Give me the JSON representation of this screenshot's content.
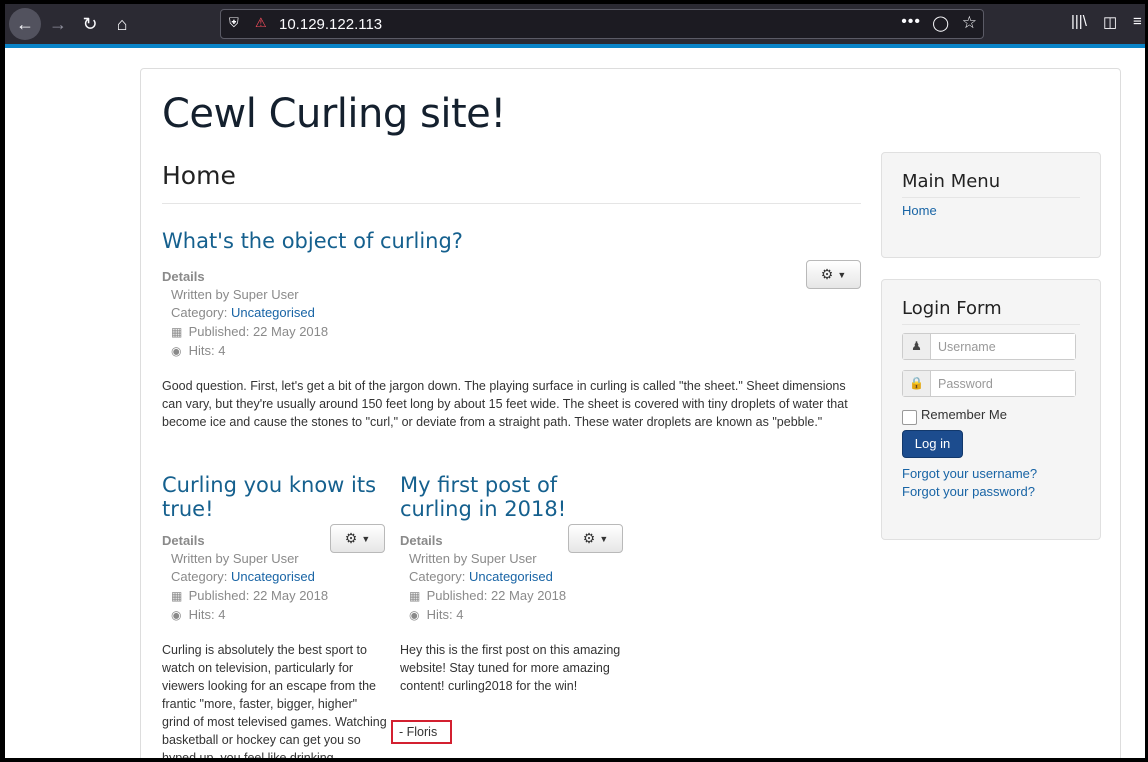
{
  "browser": {
    "url": "10.129.122.113",
    "icons": {
      "back": "arrow-left-icon",
      "forward": "arrow-right-icon",
      "reload": "reload-icon",
      "home": "home-icon",
      "shield": "shield-icon",
      "insecure": "insecure-lock-icon",
      "more": "ellipsis-icon",
      "pocket": "pocket-icon",
      "bookmark": "star-icon",
      "library": "library-icon",
      "sidebar": "sidebar-icon"
    }
  },
  "site": {
    "title": "Cewl Curling site!",
    "page_heading": "Home"
  },
  "articles": [
    {
      "title": "What's the object of curling?",
      "details_label": "Details",
      "written_by": "Written by Super User",
      "category_prefix": "Category: ",
      "category": "Uncategorised",
      "published": "Published: 22 May 2018",
      "hits": "Hits: 4",
      "body": "Good question. First, let's get a bit of the jargon down. The playing surface in curling is called \"the sheet.\" Sheet dimensions can vary, but they're usually around 150 feet long by about 15 feet wide. The sheet is covered with tiny droplets of water that become ice and cause the stones to \"curl,\" or deviate from a straight path. These water droplets are known as \"pebble.\""
    },
    {
      "title": "Curling you know its true!",
      "details_label": "Details",
      "written_by": "Written by Super User",
      "category_prefix": "Category: ",
      "category": "Uncategorised",
      "published": "Published: 22 May 2018",
      "hits": "Hits: 4",
      "body": "Curling is absolutely the best sport to watch on television, particularly for viewers looking for an escape from the frantic \"more, faster, bigger, higher\" grind of most televised games. Watching basketball or hockey can get you so hyped up, you feel like drinking"
    },
    {
      "title": "My first post of curling in 2018!",
      "details_label": "Details",
      "written_by": "Written by Super User",
      "category_prefix": "Category: ",
      "category": "Uncategorised",
      "published": "Published: 22 May 2018",
      "hits": "Hits: 4",
      "body": "Hey this is the first post on this amazing website! Stay tuned for more amazing content! curling2018 for the win!",
      "signature": "- Floris"
    }
  ],
  "main_menu": {
    "title": "Main Menu",
    "items": [
      "Home"
    ]
  },
  "login_form": {
    "title": "Login Form",
    "username_placeholder": "Username",
    "password_placeholder": "Password",
    "remember_label": "Remember Me",
    "login_button": "Log in",
    "forgot_username": "Forgot your username?",
    "forgot_password": "Forgot your password?"
  },
  "colors": {
    "link": "#1864a5",
    "article_title": "#15608e",
    "login_button": "#1c4c8e",
    "highlight_box": "#d32030",
    "browser_accent": "#0a84c8"
  }
}
